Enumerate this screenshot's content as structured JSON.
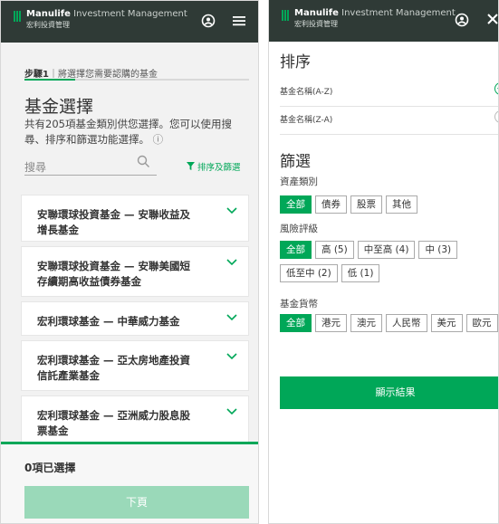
{
  "brand": {
    "name_bold": "Manulife",
    "name_rest": " Investment Management",
    "name_zh": "宏利投資管理",
    "accent": "#00a758",
    "header_bg": "#2f3a36"
  },
  "left": {
    "step_num": "步驟1",
    "step_text": "｜將選擇您需要認購的基金",
    "title": "基金選擇",
    "description": "共有205項基金類別供您選擇。您可以使用搜尋、排序和篩選功能選擇。",
    "info_icon": "ⓘ",
    "search_placeholder": "搜尋",
    "filter_link": "排序及篩選",
    "funds": [
      {
        "name": "安聯環球投資基金 — 安聯收益及增長基金"
      },
      {
        "name": "安聯環球投資基金 — 安聯美國短存續期高收益債券基金"
      },
      {
        "name": "宏利環球基金 — 中華威力基金"
      },
      {
        "name": "宏利環球基金 — 亞太房地產投資信託產業基金"
      },
      {
        "name": "宏利環球基金 — 亞洲威力股息股票基金"
      }
    ],
    "selected_count": "0項已選擇",
    "next_label": "下頁"
  },
  "right": {
    "sort_title": "排序",
    "sort_options": [
      {
        "label": "基金名稱(A-Z)",
        "checked": true
      },
      {
        "label": "基金名稱(Z-A)",
        "checked": false
      }
    ],
    "filter_title": "篩選",
    "groups": [
      {
        "label": "資產類別",
        "options": [
          "全部",
          "債券",
          "股票",
          "其他"
        ]
      },
      {
        "label": "風險評級",
        "options": [
          "全部",
          "高 (5)",
          "中至高 (4)",
          "中 (3)",
          "低至中 (2)",
          "低 (1)"
        ]
      },
      {
        "label": "基金貨幣",
        "options": [
          "全部",
          "港元",
          "澳元",
          "人民幣",
          "美元",
          "歐元"
        ]
      }
    ],
    "show_results_label": "顯示結果"
  }
}
